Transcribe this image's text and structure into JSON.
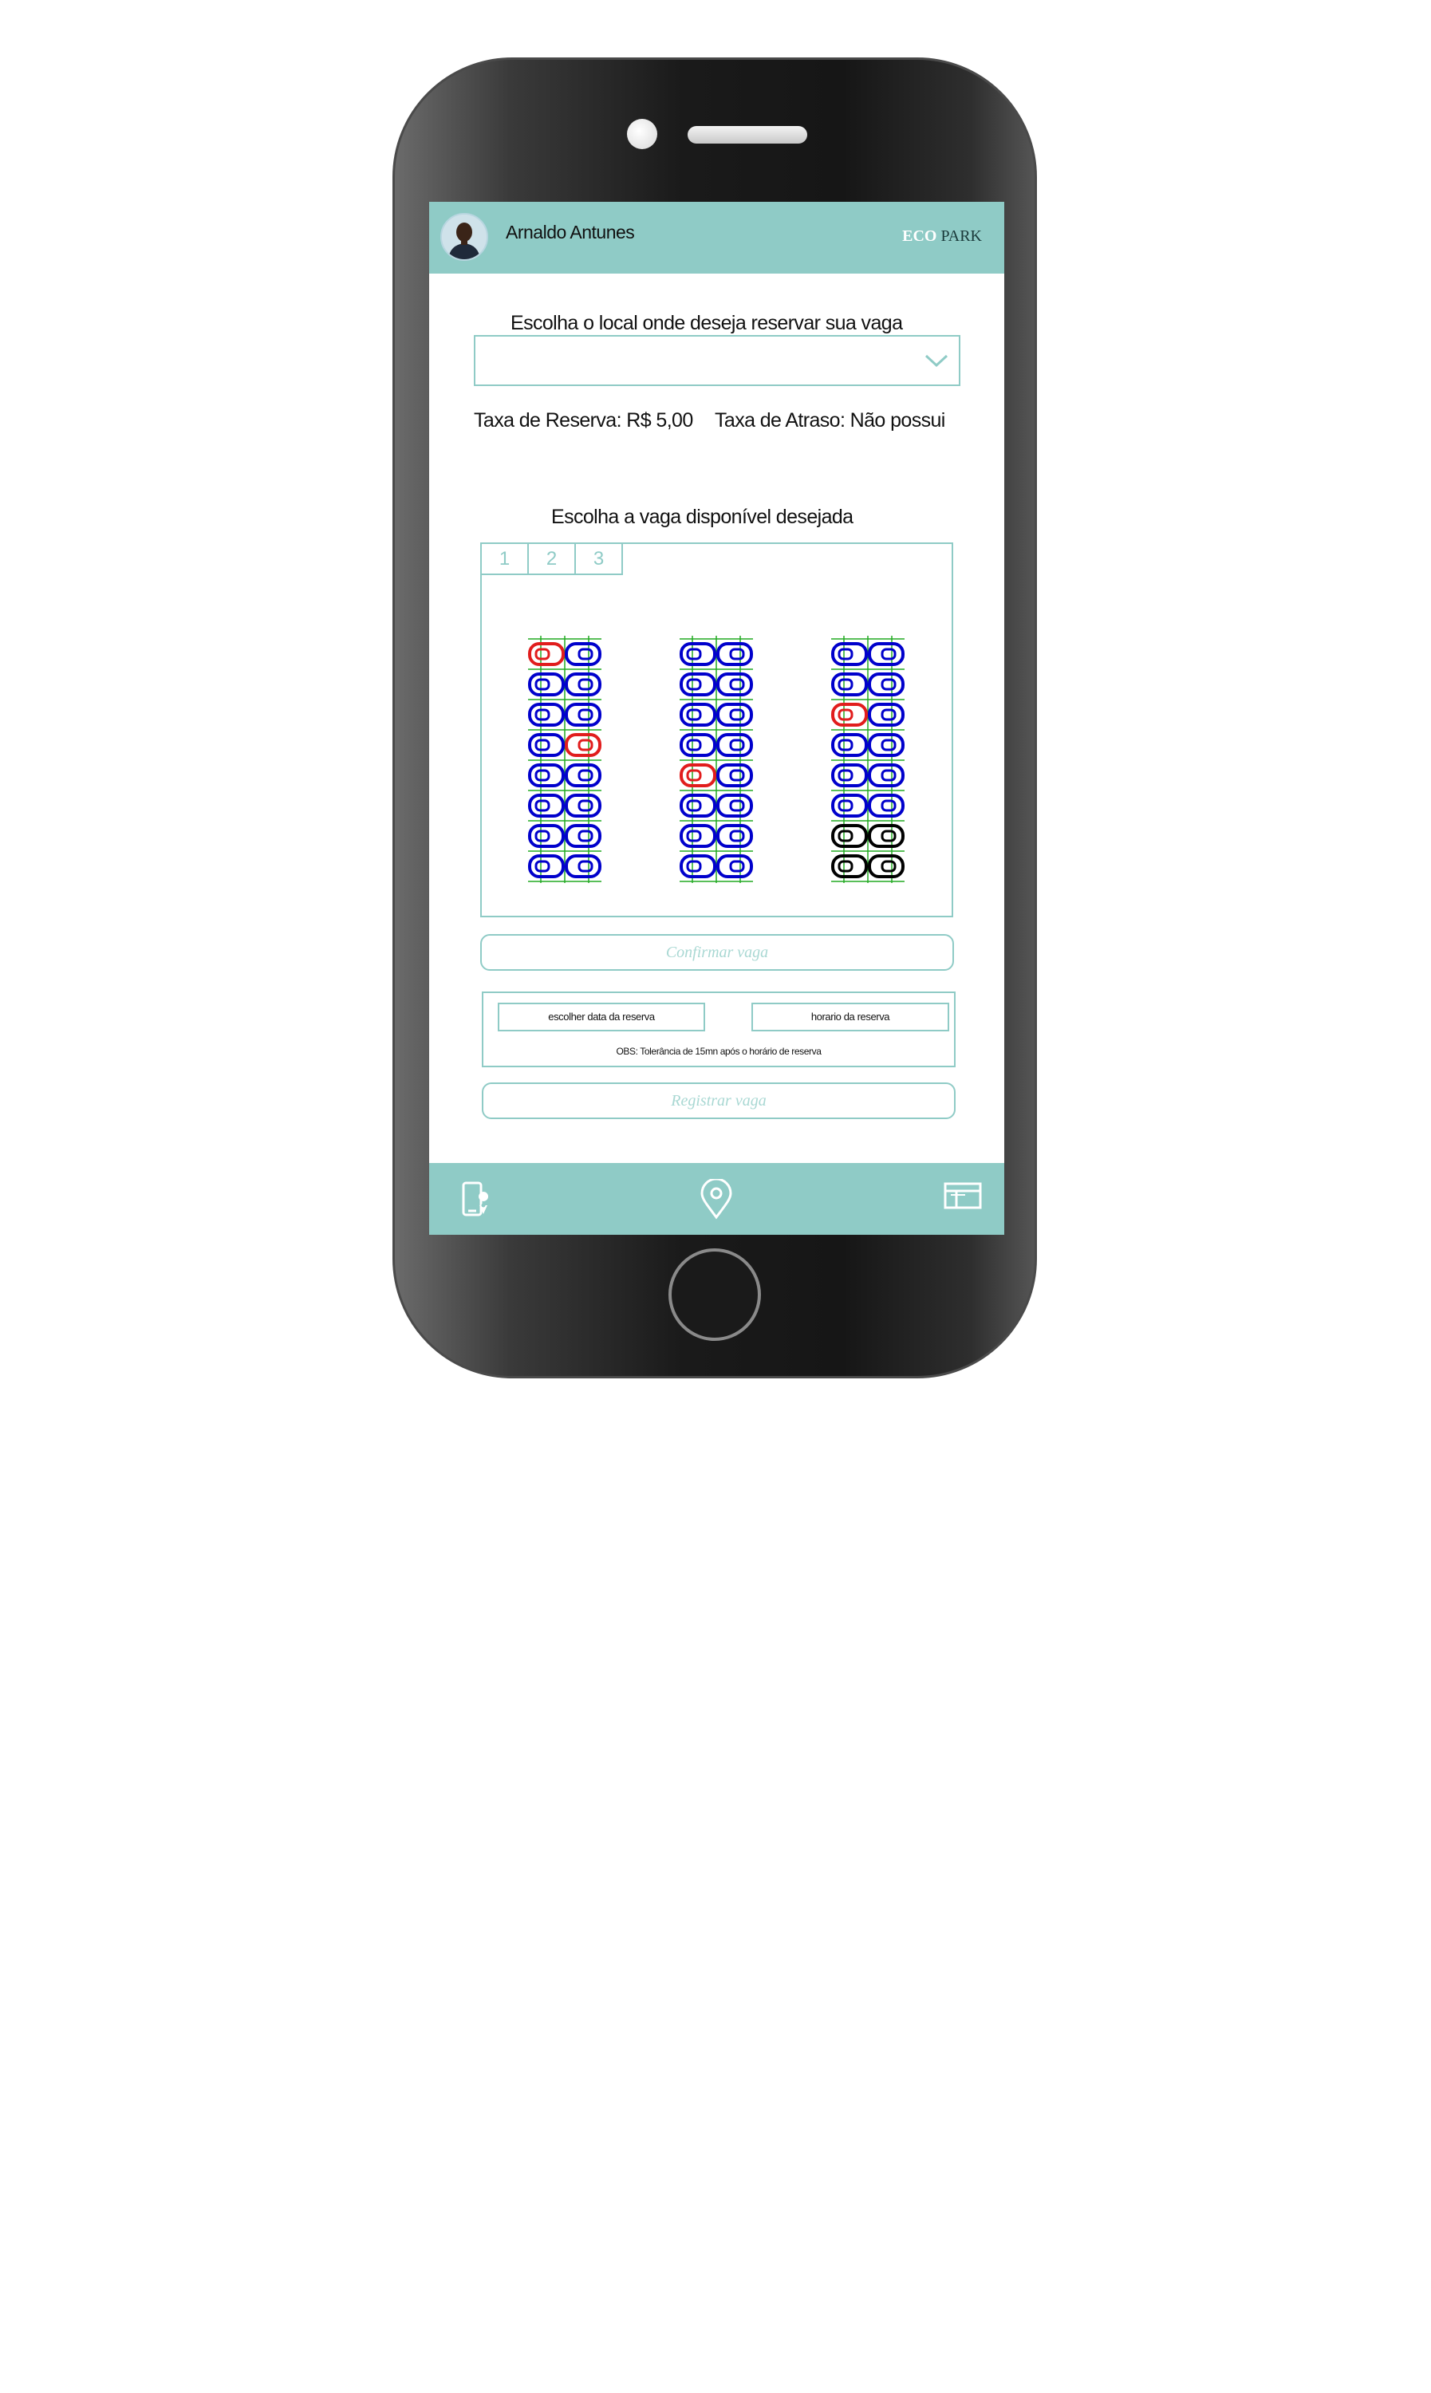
{
  "header": {
    "user_name": "Arnaldo Antunes",
    "brand_eco": "ECO",
    "brand_park": "PARK"
  },
  "location": {
    "label": "Escolha o local onde deseja reservar sua vaga",
    "selected": ""
  },
  "fees": {
    "reserve": "Taxa de Reserva: R$ 5,00",
    "late": "Taxa de Atraso: Não possui"
  },
  "spots": {
    "label": "Escolha a vaga disponível desejada",
    "tabs": [
      "1",
      "2",
      "3"
    ],
    "legend_colors": {
      "available": "#0000cc",
      "occupied": "#e11d1d",
      "unavailable": "#000000",
      "grid": "#22aa22"
    },
    "lots": [
      [
        [
          "occupied",
          "available"
        ],
        [
          "available",
          "available"
        ],
        [
          "available",
          "available"
        ],
        [
          "available",
          "occupied"
        ],
        [
          "available",
          "available"
        ],
        [
          "available",
          "available"
        ],
        [
          "available",
          "available"
        ],
        [
          "available",
          "available"
        ]
      ],
      [
        [
          "available",
          "available"
        ],
        [
          "available",
          "available"
        ],
        [
          "available",
          "available"
        ],
        [
          "available",
          "available"
        ],
        [
          "occupied",
          "available"
        ],
        [
          "available",
          "available"
        ],
        [
          "available",
          "available"
        ],
        [
          "available",
          "available"
        ]
      ],
      [
        [
          "available",
          "available"
        ],
        [
          "available",
          "available"
        ],
        [
          "occupied",
          "available"
        ],
        [
          "available",
          "available"
        ],
        [
          "available",
          "available"
        ],
        [
          "available",
          "available"
        ],
        [
          "unavailable",
          "unavailable"
        ],
        [
          "unavailable",
          "unavailable"
        ]
      ]
    ]
  },
  "actions": {
    "confirm": "Confirmar vaga",
    "date": "escolher data da reserva",
    "time": "horario da reserva",
    "obs": "OBS: Tolerância de 15mn após o horário de reserva",
    "register": "Registrar vaga"
  },
  "nav": {
    "icons": [
      "phone-location-icon",
      "map-pin-icon",
      "ticket-card-icon"
    ]
  }
}
